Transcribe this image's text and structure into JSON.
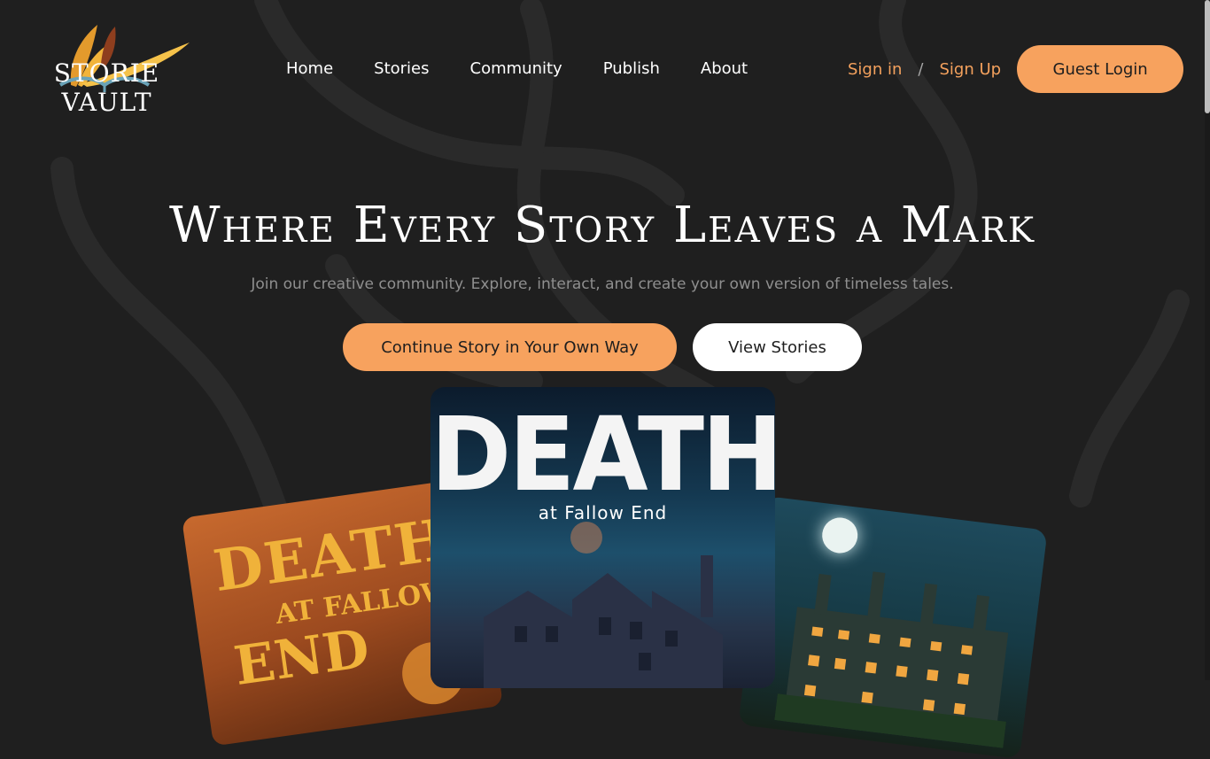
{
  "brand": {
    "logo_text": "STORIE VAULT"
  },
  "nav": {
    "items": [
      {
        "label": "Home"
      },
      {
        "label": "Stories"
      },
      {
        "label": "Community"
      },
      {
        "label": "Publish"
      },
      {
        "label": "About"
      }
    ]
  },
  "auth": {
    "sign_in": "Sign in",
    "separator": "/",
    "sign_up": "Sign Up",
    "guest_login": "Guest Login"
  },
  "hero": {
    "title": "Where Every Story Leaves a Mark",
    "subtitle": "Join our creative community. Explore, interact, and create your own version of timeless tales.",
    "primary_cta": "Continue Story in Your Own Way",
    "secondary_cta": "View Stories"
  },
  "books": {
    "left": {
      "line1": "DEATH",
      "line2": "AT FALLOW",
      "line3": "END"
    },
    "center": {
      "title": "DEATH",
      "subtitle": "at Fallow End"
    }
  },
  "colors": {
    "background": "#1f1f1f",
    "accent": "#f7a25e",
    "link_accent": "#f4a15d",
    "muted_text": "#8f8f8f"
  }
}
